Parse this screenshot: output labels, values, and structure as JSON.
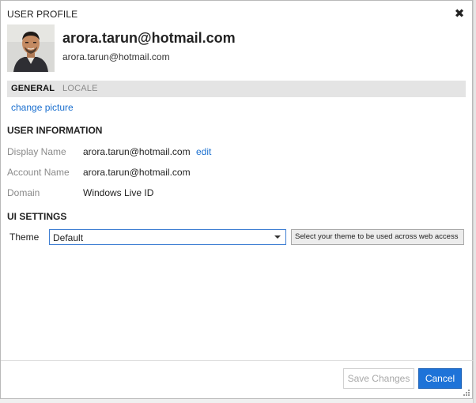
{
  "dialog": {
    "title": "USER PROFILE",
    "close_icon": "close-icon"
  },
  "profile": {
    "display_name": "arora.tarun@hotmail.com",
    "email": "arora.tarun@hotmail.com"
  },
  "tabs": [
    {
      "label": "GENERAL",
      "active": true
    },
    {
      "label": "LOCALE",
      "active": false
    }
  ],
  "change_picture_label": "change picture",
  "user_information": {
    "title": "USER INFORMATION",
    "rows": [
      {
        "label": "Display Name",
        "value": "arora.tarun@hotmail.com"
      },
      {
        "label": "Account Name",
        "value": "arora.tarun@hotmail.com"
      },
      {
        "label": "Domain",
        "value": "Windows Live ID"
      }
    ],
    "edit_label": "edit"
  },
  "ui_settings": {
    "title": "UI SETTINGS",
    "theme_label": "Theme",
    "theme_value": "Default",
    "theme_hint": "Select your theme to be used across web access"
  },
  "footer": {
    "save_label": "Save Changes",
    "cancel_label": "Cancel"
  },
  "colors": {
    "link": "#1a6fcf",
    "primary_button": "#1e73d8",
    "tab_bar": "#e4e4e4"
  }
}
